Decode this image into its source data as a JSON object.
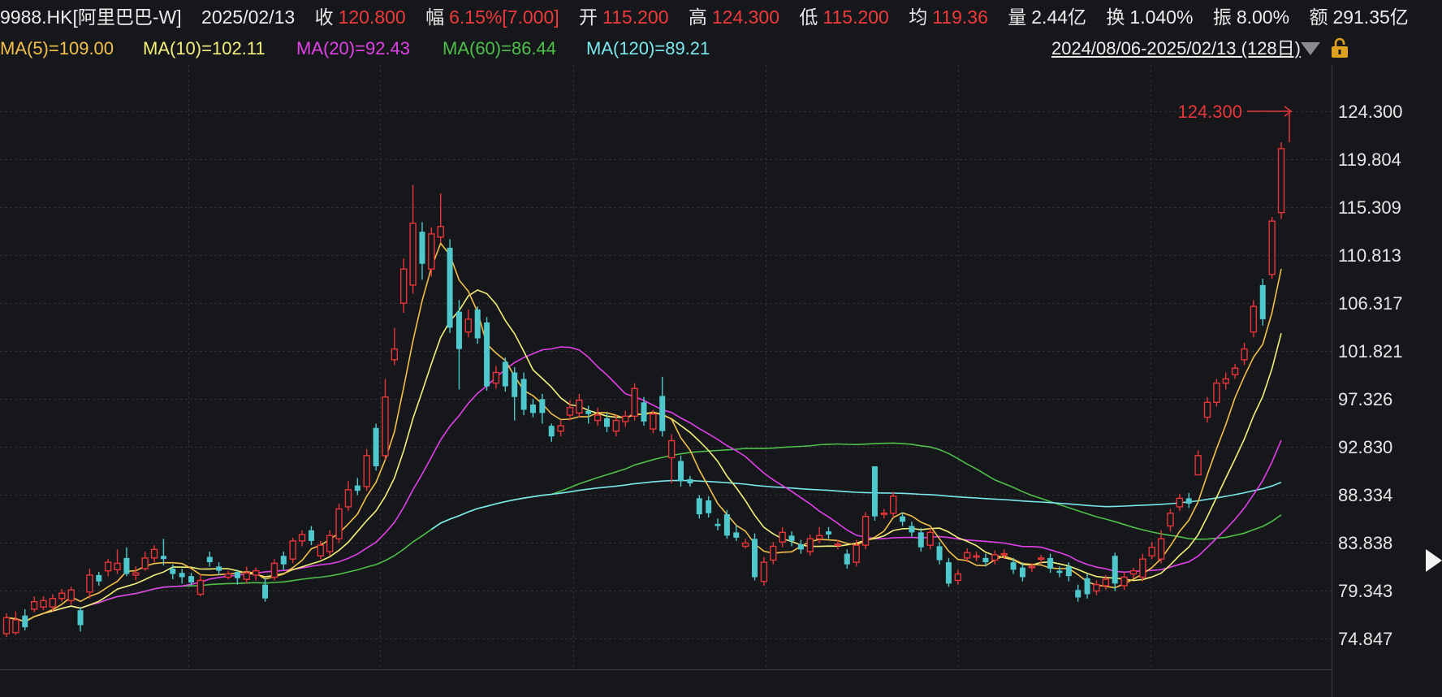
{
  "header": {
    "code": "9988.HK[阿里巴巴-W]",
    "date": "2025/02/13",
    "close_label": "收",
    "close": "120.800",
    "change_label": "幅",
    "change": "6.15%[7.000]",
    "open_label": "开",
    "open": "115.200",
    "high_label": "高",
    "high": "124.300",
    "low_label": "低",
    "low": "115.200",
    "avg_label": "均",
    "avg": "119.36",
    "volume_label": "量",
    "volume": "2.44亿",
    "turnover_label": "换",
    "turnover": "1.040%",
    "amplitude_label": "振",
    "amplitude": "8.00%",
    "amount_label": "额",
    "amount": "291.35亿"
  },
  "ma_bar": {
    "ma5": "MA(5)=109.00",
    "ma10": "MA(10)=102.11",
    "ma20": "MA(20)=92.43",
    "ma60": "MA(60)=86.44",
    "ma120": "MA(120)=89.21"
  },
  "range_text": "2024/08/06-2025/02/13 (128日)",
  "colors": {
    "background": "#16171b",
    "up": "#e8353a",
    "down": "#4fc8cd",
    "ma5": "#f2c04a",
    "ma10": "#f2f07a",
    "ma20": "#e040e8",
    "ma60": "#4ec04a",
    "ma120": "#7ae8ec",
    "grid": "#2f3035"
  },
  "icons": [
    "dropdown-triangle-icon",
    "lock-icon",
    "right-arrow-icon"
  ],
  "chart_data": {
    "type": "candlestick",
    "y_ticks": [
      "124.300",
      "119.804",
      "115.309",
      "110.813",
      "106.317",
      "101.821",
      "97.326",
      "92.830",
      "88.334",
      "83.838",
      "79.343",
      "74.847"
    ],
    "ylim": [
      74.847,
      124.3
    ],
    "high_marker": "124.300",
    "candles": [
      [
        75.3,
        76.8,
        75.0,
        77.2
      ],
      [
        75.4,
        76.6,
        75.2,
        77.4
      ],
      [
        77.0,
        75.9,
        75.6,
        77.6
      ],
      [
        77.6,
        78.3,
        77.3,
        78.8
      ],
      [
        77.8,
        78.4,
        77.5,
        78.8
      ],
      [
        77.8,
        78.6,
        77.4,
        79.0
      ],
      [
        78.6,
        79.1,
        78.3,
        79.5
      ],
      [
        78.4,
        79.4,
        78.0,
        79.7
      ],
      [
        77.5,
        76.1,
        75.5,
        77.8
      ],
      [
        79.2,
        80.8,
        78.6,
        81.4
      ],
      [
        80.8,
        80.2,
        79.8,
        81.1
      ],
      [
        81.2,
        82.0,
        80.7,
        82.3
      ],
      [
        81.3,
        81.9,
        80.9,
        83.2
      ],
      [
        82.4,
        80.9,
        80.7,
        83.4
      ],
      [
        80.8,
        81.0,
        80.3,
        81.6
      ],
      [
        81.4,
        82.4,
        81.2,
        83.0
      ],
      [
        82.4,
        83.2,
        82.0,
        83.6
      ],
      [
        82.6,
        82.3,
        81.7,
        84.2
      ],
      [
        81.4,
        80.9,
        80.4,
        81.8
      ],
      [
        81.0,
        80.6,
        80.0,
        81.4
      ],
      [
        80.7,
        80.1,
        79.8,
        81.0
      ],
      [
        79.0,
        80.3,
        78.8,
        80.9
      ],
      [
        82.5,
        82.0,
        81.6,
        83.0
      ],
      [
        81.6,
        81.2,
        80.8,
        82.0
      ],
      [
        80.6,
        80.9,
        80.4,
        81.2
      ],
      [
        81.1,
        80.5,
        79.9,
        81.3
      ],
      [
        80.4,
        81.0,
        80.0,
        81.6
      ],
      [
        80.8,
        81.2,
        80.3,
        81.5
      ],
      [
        79.9,
        78.6,
        78.3,
        80.5
      ],
      [
        80.6,
        81.9,
        80.3,
        82.3
      ],
      [
        82.6,
        81.8,
        81.3,
        83.0
      ],
      [
        82.3,
        84.0,
        81.9,
        84.3
      ],
      [
        84.0,
        84.6,
        83.5,
        85.0
      ],
      [
        85.0,
        84.0,
        83.6,
        85.4
      ],
      [
        82.6,
        83.6,
        82.3,
        84.0
      ],
      [
        83.0,
        84.5,
        82.6,
        85.0
      ],
      [
        84.2,
        87.0,
        83.8,
        87.5
      ],
      [
        87.2,
        88.8,
        86.8,
        89.6
      ],
      [
        89.2,
        88.7,
        88.3,
        89.9
      ],
      [
        89.1,
        92.0,
        88.7,
        92.6
      ],
      [
        94.6,
        91.0,
        90.6,
        95.0
      ],
      [
        92.0,
        97.5,
        91.6,
        99.2
      ],
      [
        101.0,
        102.0,
        100.5,
        104.0
      ],
      [
        106.3,
        109.5,
        105.4,
        110.5
      ],
      [
        108.0,
        113.8,
        107.2,
        117.4
      ],
      [
        113.0,
        110.0,
        108.5,
        113.9
      ],
      [
        109.5,
        112.8,
        108.8,
        113.4
      ],
      [
        112.5,
        113.5,
        112.0,
        116.6
      ],
      [
        111.5,
        104.0,
        103.5,
        112.3
      ],
      [
        105.5,
        102.0,
        98.2,
        106.6
      ],
      [
        103.6,
        104.8,
        103.1,
        105.7
      ],
      [
        105.7,
        103.0,
        102.5,
        106.0
      ],
      [
        104.5,
        98.5,
        98.1,
        105.0
      ],
      [
        98.8,
        99.8,
        98.3,
        100.4
      ],
      [
        100.8,
        98.5,
        98.0,
        101.2
      ],
      [
        99.8,
        97.5,
        95.3,
        100.3
      ],
      [
        99.2,
        96.3,
        95.8,
        99.8
      ],
      [
        96.8,
        96.0,
        95.6,
        97.3
      ],
      [
        97.3,
        96.0,
        95.0,
        97.8
      ],
      [
        94.8,
        93.8,
        93.3,
        95.0
      ],
      [
        94.3,
        94.8,
        93.8,
        95.3
      ],
      [
        95.8,
        96.5,
        95.3,
        97.2
      ],
      [
        96.0,
        97.2,
        95.6,
        97.8
      ],
      [
        96.2,
        95.9,
        95.0,
        96.7
      ],
      [
        95.3,
        95.8,
        94.8,
        96.5
      ],
      [
        95.5,
        94.7,
        94.2,
        96.0
      ],
      [
        94.3,
        95.3,
        93.8,
        95.8
      ],
      [
        95.2,
        95.7,
        94.7,
        96.2
      ],
      [
        95.7,
        98.3,
        95.3,
        98.8
      ],
      [
        97.0,
        95.2,
        94.8,
        97.5
      ],
      [
        94.5,
        95.9,
        94.1,
        96.3
      ],
      [
        97.6,
        94.3,
        93.8,
        99.4
      ],
      [
        91.8,
        93.4,
        89.4,
        94.0
      ],
      [
        91.5,
        89.6,
        89.1,
        92.0
      ],
      [
        89.8,
        89.4,
        89.1,
        90.1
      ],
      [
        88.0,
        86.5,
        86.1,
        88.3
      ],
      [
        87.8,
        86.6,
        86.2,
        88.2
      ],
      [
        85.6,
        85.4,
        85.0,
        86.1
      ],
      [
        86.5,
        84.5,
        84.2,
        86.9
      ],
      [
        84.8,
        84.3,
        84.0,
        85.5
      ],
      [
        83.5,
        83.8,
        83.3,
        84.2
      ],
      [
        84.2,
        80.6,
        80.3,
        84.7
      ],
      [
        80.2,
        82.0,
        79.8,
        82.5
      ],
      [
        82.2,
        83.5,
        81.8,
        83.9
      ],
      [
        83.9,
        84.8,
        83.4,
        85.3
      ],
      [
        84.5,
        84.0,
        83.5,
        84.9
      ],
      [
        83.7,
        83.2,
        82.8,
        84.1
      ],
      [
        83.0,
        84.2,
        82.6,
        84.6
      ],
      [
        84.2,
        84.5,
        83.8,
        85.3
      ],
      [
        84.9,
        84.6,
        84.2,
        85.3
      ],
      [
        83.6,
        83.7,
        83.2,
        84.1
      ],
      [
        82.8,
        81.8,
        81.4,
        83.2
      ],
      [
        82.0,
        83.6,
        81.6,
        84.1
      ],
      [
        83.6,
        86.3,
        83.2,
        86.7
      ],
      [
        91.0,
        86.3,
        85.9,
        91.0
      ],
      [
        86.5,
        86.6,
        86.1,
        87.0
      ],
      [
        86.6,
        88.2,
        86.2,
        88.6
      ],
      [
        86.3,
        85.8,
        85.4,
        86.7
      ],
      [
        85.4,
        84.8,
        84.4,
        85.8
      ],
      [
        84.8,
        83.4,
        83.0,
        85.2
      ],
      [
        83.6,
        84.8,
        83.2,
        85.2
      ],
      [
        83.5,
        82.2,
        81.8,
        83.9
      ],
      [
        82.0,
        80.0,
        79.7,
        82.4
      ],
      [
        80.3,
        80.9,
        79.9,
        81.3
      ],
      [
        82.4,
        82.9,
        82.0,
        83.3
      ],
      [
        82.6,
        82.6,
        82.1,
        83.0
      ],
      [
        82.4,
        82.0,
        81.6,
        82.8
      ],
      [
        82.2,
        82.7,
        81.8,
        83.1
      ],
      [
        82.8,
        82.8,
        82.3,
        83.2
      ],
      [
        82.0,
        81.3,
        80.9,
        82.4
      ],
      [
        81.5,
        80.6,
        80.2,
        82.0
      ],
      [
        81.5,
        81.6,
        81.1,
        81.9
      ],
      [
        82.3,
        82.4,
        81.8,
        82.7
      ],
      [
        82.4,
        81.4,
        81.0,
        82.8
      ],
      [
        81.2,
        81.0,
        80.6,
        81.6
      ],
      [
        81.6,
        80.7,
        80.2,
        82.0
      ],
      [
        79.4,
        78.7,
        78.3,
        79.9
      ],
      [
        80.5,
        79.0,
        78.6,
        80.9
      ],
      [
        79.3,
        79.9,
        78.9,
        80.3
      ],
      [
        79.8,
        80.4,
        79.4,
        80.8
      ],
      [
        82.6,
        80.0,
        79.3,
        82.9
      ],
      [
        79.8,
        80.6,
        79.4,
        81.1
      ],
      [
        80.9,
        81.2,
        80.5,
        81.5
      ],
      [
        80.6,
        82.3,
        80.2,
        82.8
      ],
      [
        82.6,
        83.4,
        82.3,
        83.9
      ],
      [
        82.3,
        84.2,
        81.9,
        85.0
      ],
      [
        85.4,
        86.6,
        84.9,
        87.0
      ],
      [
        87.2,
        88.0,
        86.8,
        88.4
      ],
      [
        88.0,
        87.5,
        87.1,
        88.5
      ],
      [
        90.2,
        92.0,
        90.6,
        92.5
      ],
      [
        95.6,
        97.0,
        95.1,
        97.5
      ],
      [
        97.0,
        98.8,
        96.6,
        99.2
      ],
      [
        98.8,
        99.2,
        98.2,
        99.8
      ],
      [
        99.6,
        100.2,
        99.2,
        100.6
      ],
      [
        101.0,
        102.0,
        100.5,
        102.6
      ],
      [
        103.6,
        106.0,
        103.1,
        106.6
      ],
      [
        108.0,
        104.8,
        104.2,
        108.6
      ],
      [
        109.0,
        114.0,
        108.6,
        114.4
      ],
      [
        114.8,
        120.8,
        114.2,
        121.4
      ]
    ]
  }
}
